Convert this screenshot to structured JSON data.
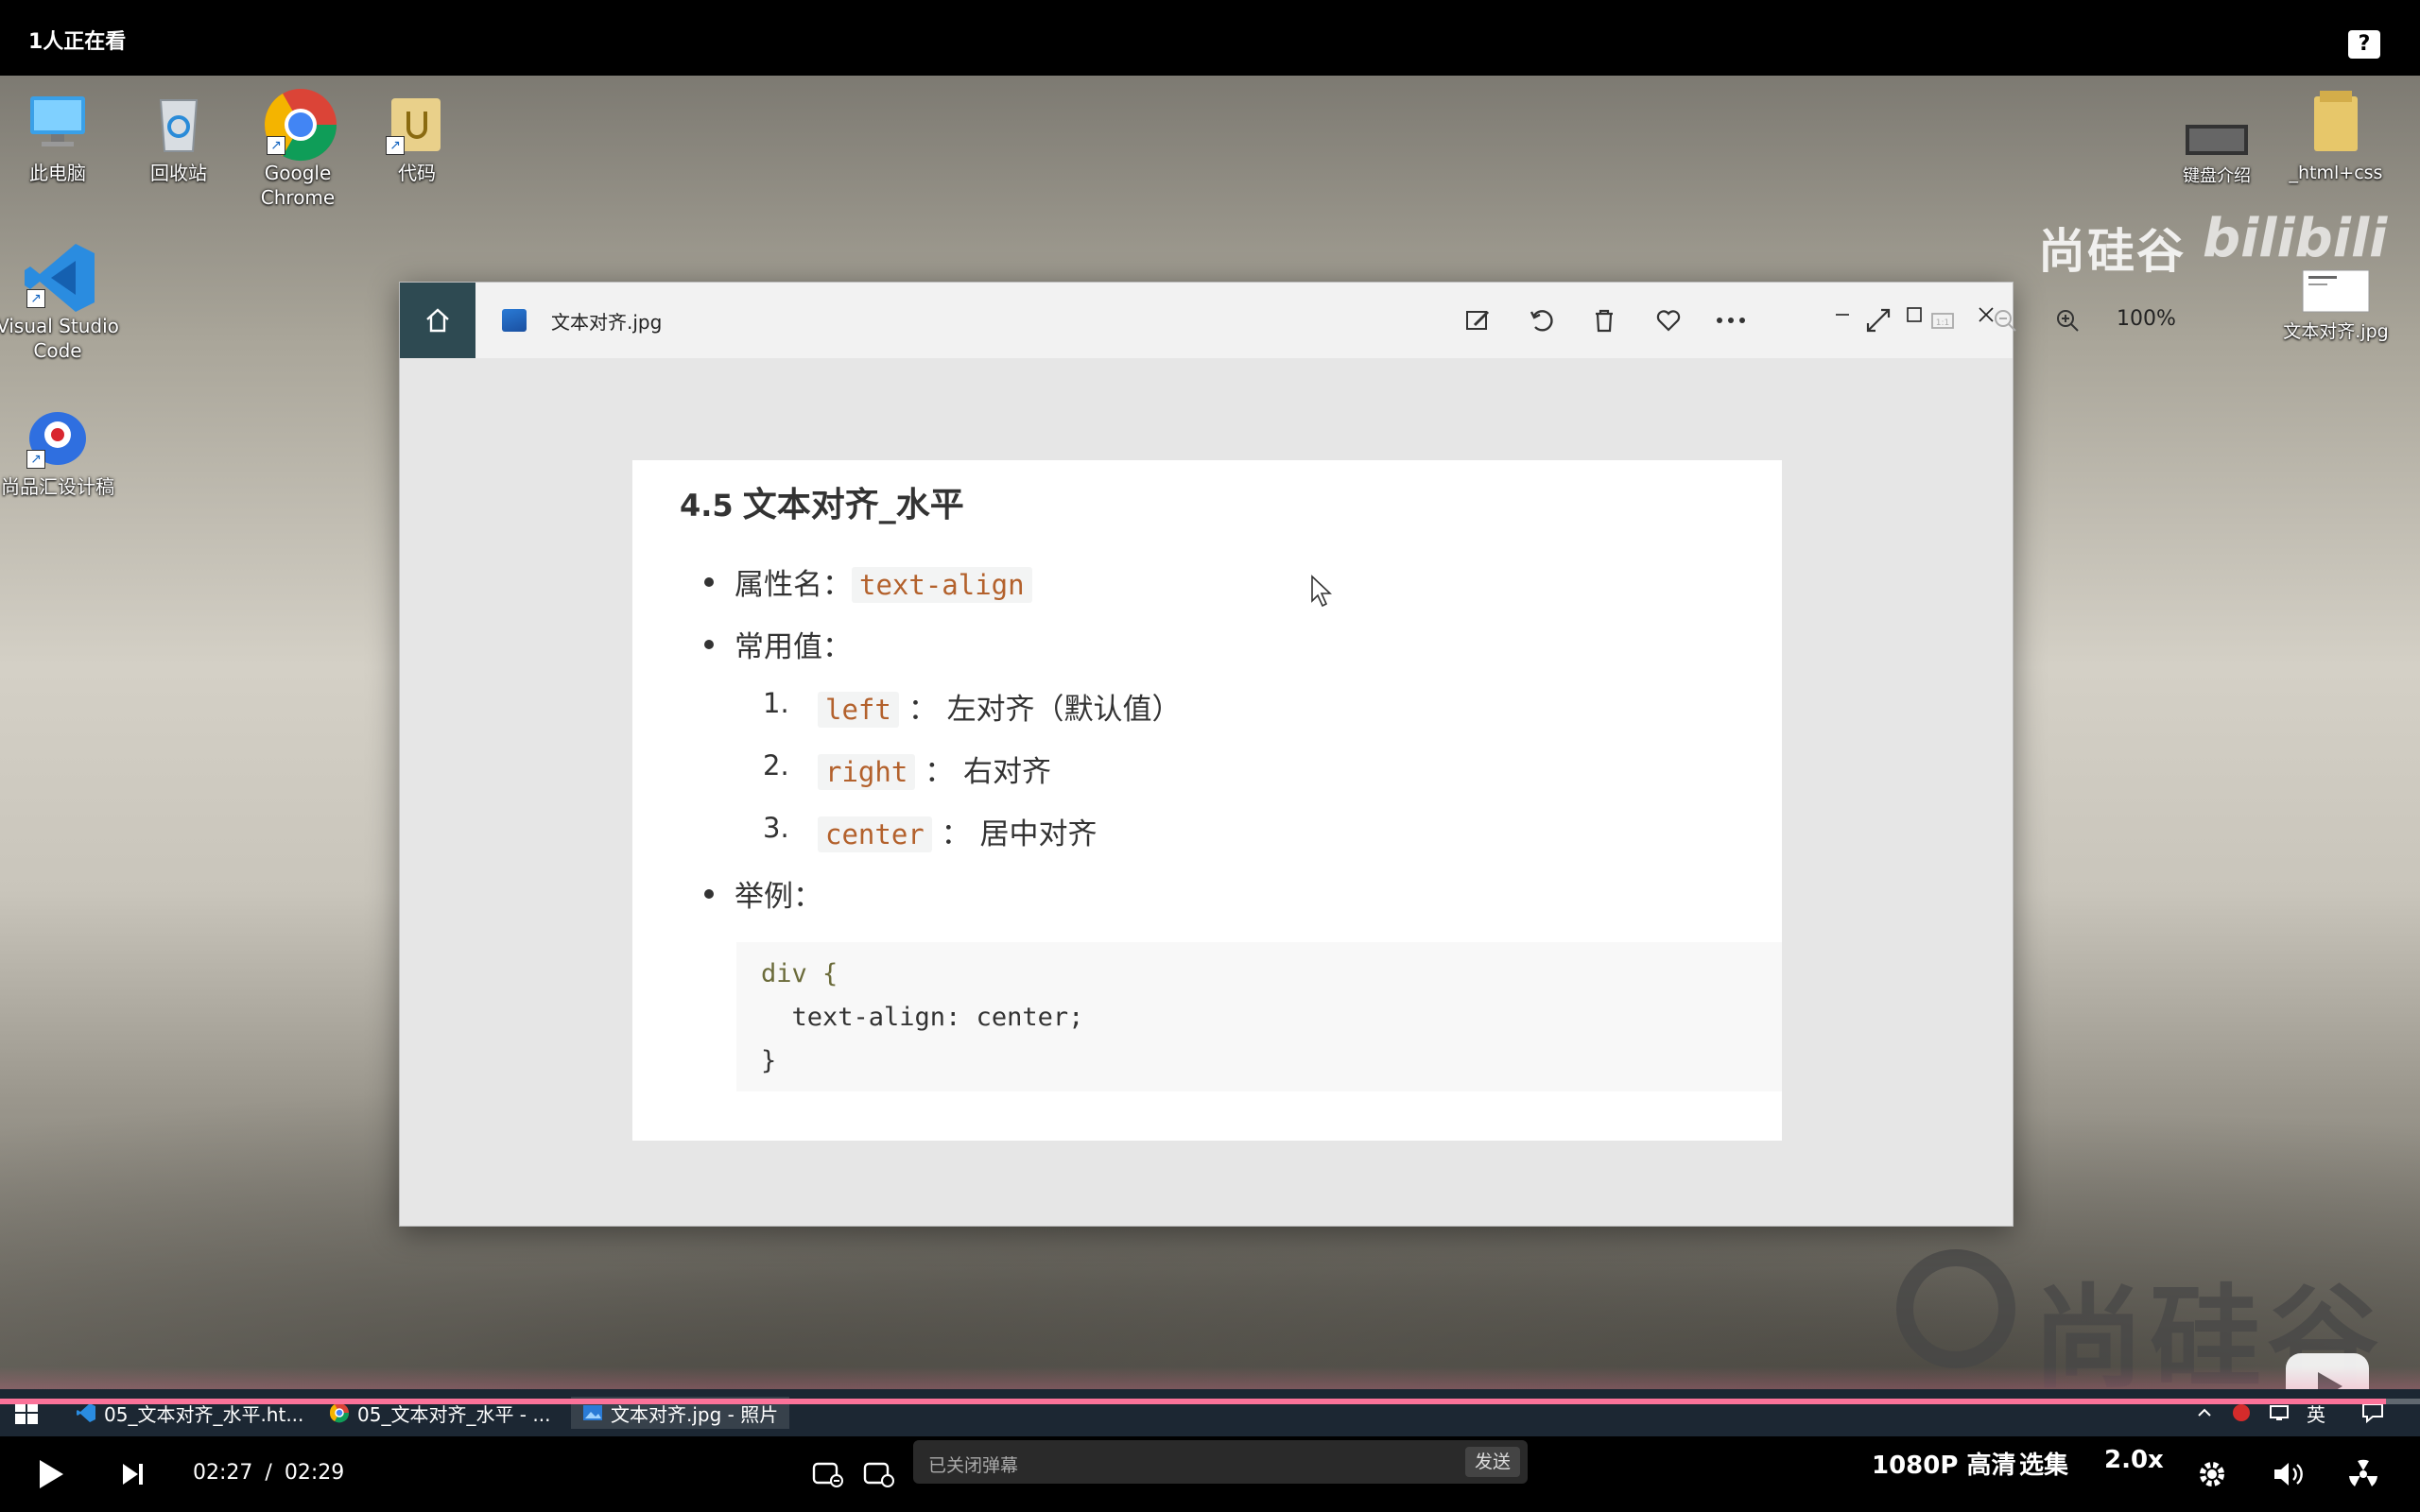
{
  "player": {
    "viewers": "1人正在看",
    "help": "?",
    "time_current": "02:27",
    "time_separator": "/",
    "time_total": "02:29",
    "progress": 0.986,
    "danmaku_placeholder": "已关闭弹幕",
    "send_label": "发送",
    "quality": "1080P 高清",
    "episodes": "选集",
    "speed": "2.0x"
  },
  "desktop": {
    "icons": [
      {
        "label": "此电脑"
      },
      {
        "label": "回收站"
      },
      {
        "label": "Google Chrome"
      },
      {
        "label": "代码"
      },
      {
        "label": "Visual Studio Code"
      },
      {
        "label": "尚品汇设计稿"
      },
      {
        "label": "键盘介绍"
      },
      {
        "label": "_html+css"
      },
      {
        "label": "文本对齐.jpg"
      }
    ],
    "watermark_top": "尚硅谷",
    "watermark_bili": "bilibili",
    "watermark_bottom": "尚硅谷"
  },
  "photos_window": {
    "file_name": "文本对齐.jpg",
    "zoom": "100%"
  },
  "document": {
    "heading_num": "4.5",
    "heading": "文本对齐_水平",
    "prop_label": "属性名：",
    "prop_value": "text-align",
    "values_label": "常用值：",
    "items": [
      {
        "num": "1.",
        "code": "left",
        "sep": "：",
        "desc": "左对齐（默认值）"
      },
      {
        "num": "2.",
        "code": "right",
        "sep": "：",
        "desc": "右对齐"
      },
      {
        "num": "3.",
        "code": "center",
        "sep": "：",
        "desc": "居中对齐"
      }
    ],
    "example_label": "举例：",
    "code_lines": [
      "div {",
      "  text-align: center;",
      "}"
    ]
  },
  "taskbar": {
    "items": [
      {
        "label": "05_文本对齐_水平.ht..."
      },
      {
        "label": "05_文本对齐_水平 - ..."
      },
      {
        "label": "文本对齐.jpg - 照片"
      }
    ],
    "tray_lang": "英"
  }
}
